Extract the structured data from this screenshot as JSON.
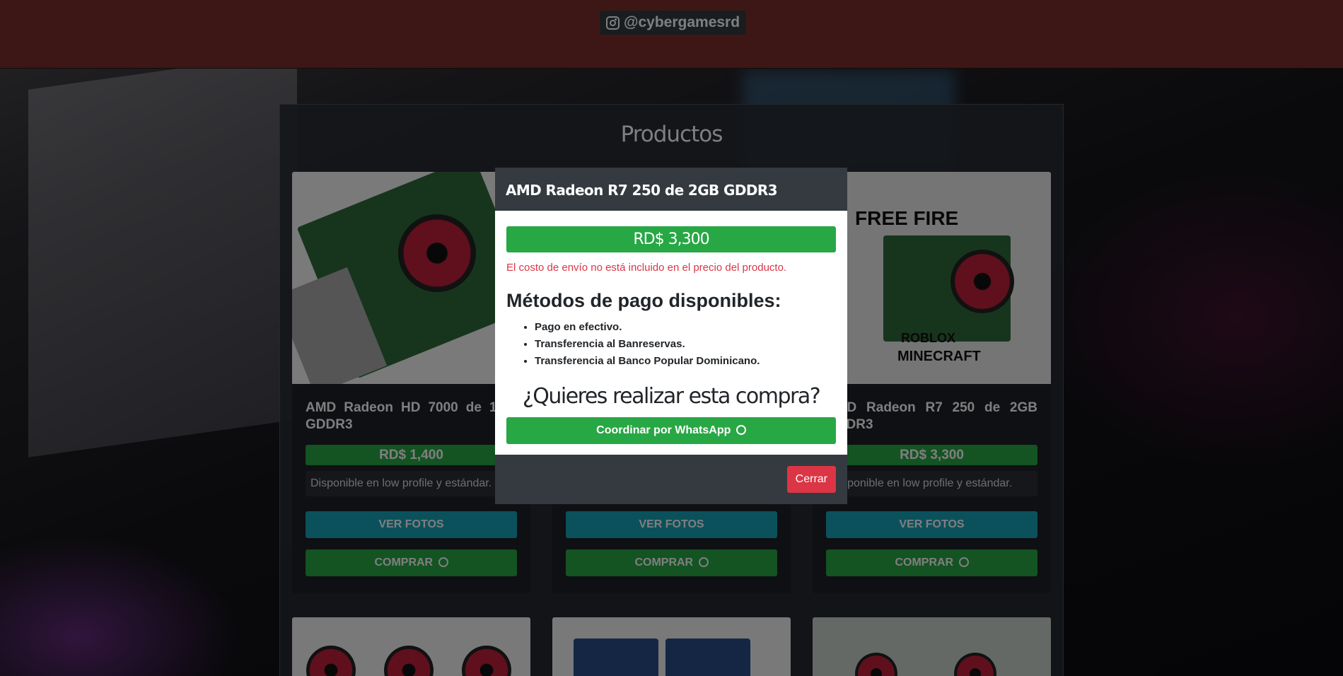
{
  "header": {
    "instagram_handle": "@cybergamesrd"
  },
  "products_section": {
    "title": "Productos",
    "cards": [
      {
        "title": "AMD Radeon HD 7000 de 1GB GDDR3",
        "price": "RD$ 1,400",
        "description": "Disponible en low profile y estándar.",
        "photos_label": "VER FOTOS",
        "buy_label": "COMPRAR"
      },
      {
        "title": "",
        "price": "",
        "description": "",
        "photos_label": "VER FOTOS",
        "buy_label": "COMPRAR"
      },
      {
        "title": "AMD Radeon R7 250 de 2GB GDDR3",
        "price": "RD$ 3,300",
        "description": "Disponible en low profile y estándar.",
        "photos_label": "VER FOTOS",
        "buy_label": "COMPRAR"
      }
    ]
  },
  "modal": {
    "title": "AMD Radeon R7 250 de 2GB GDDR3",
    "price": "RD$ 3,300",
    "shipping_note": "El costo de envío no está incluido en el precio del producto.",
    "payment_title": "Métodos de pago disponibles:",
    "payment_methods": [
      "Pago en efectivo.",
      "Transferencia al Banreservas.",
      "Transferencia al Banco Popular Dominicano."
    ],
    "question": "¿Quieres realizar esta compra?",
    "whatsapp_button": "Coordinar por WhatsApp",
    "close_button": "Cerrar"
  },
  "image_texts": {
    "games_banner": [
      "FREE FIRE",
      "ROBLOX",
      "MINECRAFT"
    ]
  },
  "colors": {
    "header_bg": "#7a2e2b",
    "success": "#28a745",
    "info": "#17a2b8",
    "danger": "#dc3545",
    "dark": "#343a40"
  }
}
